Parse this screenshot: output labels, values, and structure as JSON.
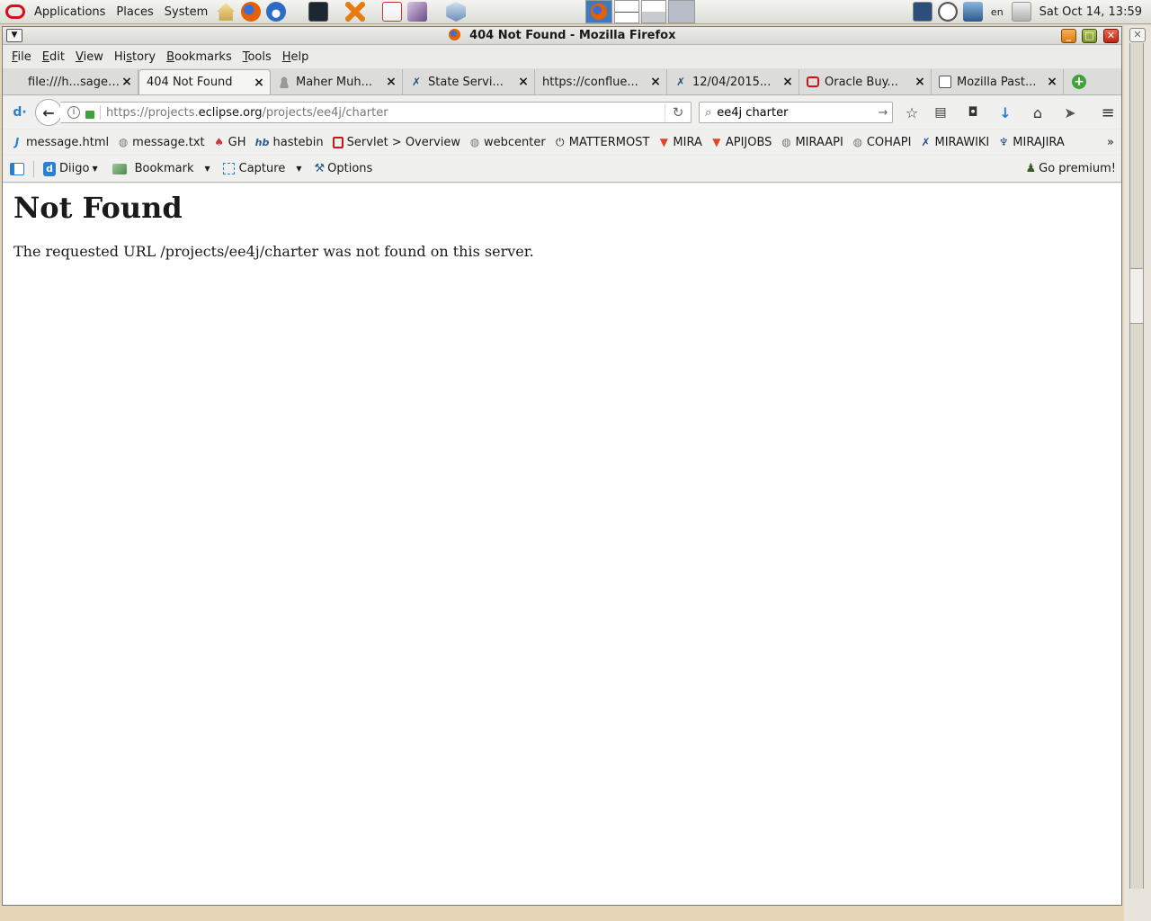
{
  "panel": {
    "menus": [
      "Applications",
      "Places",
      "System"
    ],
    "lang": "en",
    "clock": "Sat Oct 14, 13:59"
  },
  "window": {
    "title": "404 Not Found - Mozilla Firefox"
  },
  "menubar": {
    "items": [
      {
        "underline": "F",
        "rest": "ile"
      },
      {
        "underline": "E",
        "rest": "dit"
      },
      {
        "underline": "V",
        "rest": "iew"
      },
      {
        "pre": "Hi",
        "underline": "s",
        "rest": "tory"
      },
      {
        "underline": "B",
        "rest": "ookmarks"
      },
      {
        "underline": "T",
        "rest": "ools"
      },
      {
        "underline": "H",
        "rest": "elp"
      }
    ]
  },
  "tabs": [
    {
      "label": "file:///h...sage.txt",
      "icon": "file-icon",
      "active": false
    },
    {
      "label": "404 Not Found",
      "icon": "none",
      "active": true
    },
    {
      "label": "Maher Muh...",
      "icon": "user-icon",
      "active": false
    },
    {
      "label": "State Servi...",
      "icon": "jira-icon",
      "active": false
    },
    {
      "label": "https://conflue...",
      "icon": "none",
      "active": false
    },
    {
      "label": "12/04/2015...",
      "icon": "jira-icon",
      "active": false
    },
    {
      "label": "Oracle Buy...",
      "icon": "oracle-icon",
      "active": false
    },
    {
      "label": "Mozilla Past...",
      "icon": "clipboard-icon",
      "active": false
    }
  ],
  "nav": {
    "url_prefix": "https://projects.",
    "url_domain": "eclipse.org",
    "url_path": "/projects/ee4j/charter",
    "search_value": "ee4j charter"
  },
  "bookmarks": [
    {
      "label": "message.html",
      "icon": "j"
    },
    {
      "label": "message.txt",
      "icon": "globe"
    },
    {
      "label": "GH",
      "icon": "gh"
    },
    {
      "label": "hastebin",
      "icon": "hb"
    },
    {
      "label": "Servlet > Overview",
      "icon": "servlet"
    },
    {
      "label": "webcenter",
      "icon": "globe"
    },
    {
      "label": "MATTERMOST",
      "icon": "mm"
    },
    {
      "label": "MIRA",
      "icon": "gitlab"
    },
    {
      "label": "APIJOBS",
      "icon": "gitlab"
    },
    {
      "label": "MIRAAPI",
      "icon": "globe"
    },
    {
      "label": "COHAPI",
      "icon": "globe"
    },
    {
      "label": "MIRAWIKI",
      "icon": "jira"
    },
    {
      "label": "MIRAJIRA",
      "icon": "jira2"
    }
  ],
  "diigo": {
    "diigo_label": "Diigo",
    "bookmark_label": "Bookmark",
    "capture_label": "Capture",
    "options_label": "Options",
    "premium_label": "Go premium!"
  },
  "page": {
    "heading": "Not Found",
    "message": "The requested URL /projects/ee4j/charter was not found on this server."
  },
  "colors": {
    "oracle_red": "#d0131b",
    "firefox_orange": "#e66000",
    "link_blue": "#1a5fb4"
  }
}
